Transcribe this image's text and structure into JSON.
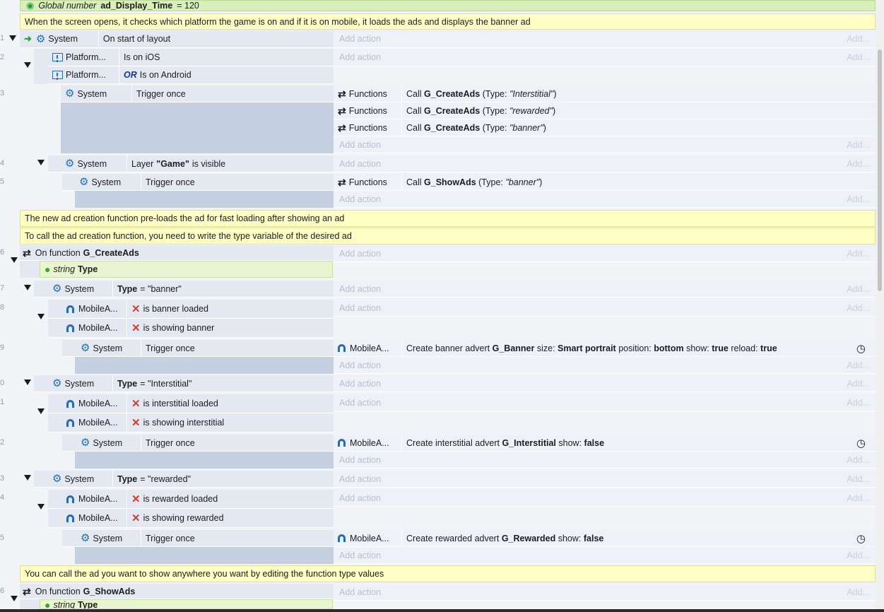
{
  "global_var": {
    "prefix": "Global number",
    "name": "ad_Display_Time",
    "value": "= 120"
  },
  "comments": [
    "When the screen opens, it checks which platform the game is on and if it is on mobile, it loads the ads and displays the banner ad",
    "The new ad creation function pre-loads the ad for fast loading after showing an ad",
    "To call the ad creation function, you need to write the type variable of the desired ad",
    "You can call the ad you want to show anywhere you want by editing the function type values"
  ],
  "line_numbers": [
    "1",
    "2",
    "3",
    "4",
    "5",
    "6",
    "7",
    "8",
    "9",
    "0",
    "1",
    "2",
    "3",
    "4",
    "5",
    "6"
  ],
  "labels": {
    "system": "System",
    "platform": "Platform...",
    "mobile": "MobileA...",
    "functions": "Functions",
    "add_action": "Add action",
    "add": "Add...",
    "trigger_once": "Trigger once",
    "or": "OR",
    "string": "string",
    "type_param": "Type"
  },
  "events": {
    "e1_cond": "On start of layout",
    "e2_c1": "Is on iOS",
    "e2_c2": "Is on Android",
    "e3_actions": [
      {
        "fn": "G_CreateAds",
        "arg": "\"Interstitial\""
      },
      {
        "fn": "G_CreateAds",
        "arg": "\"rewarded\""
      },
      {
        "fn": "G_CreateAds",
        "arg": "\"banner\""
      }
    ],
    "e4_pre": "Layer",
    "e4_layer": "\"Game\"",
    "e4_post": "is visible",
    "e5_fn": "G_ShowAds",
    "e5_arg": "\"banner\"",
    "call": "Call",
    "type_open": "(Type:",
    "close": ")",
    "e6_prefix": "On function",
    "e6_fn": "G_CreateAds",
    "e7_val": "= \"banner\"",
    "e8_c1": "is banner loaded",
    "e8_c2": "is showing banner",
    "e9_act_pre": "Create banner advert",
    "e9_name": "G_Banner",
    "e9_size_lbl": "size:",
    "e9_size": "Smart portrait",
    "e9_pos_lbl": "position:",
    "e9_pos": "bottom",
    "e9_show_lbl": "show:",
    "e9_show": "true",
    "e9_reload_lbl": "reload:",
    "e9_reload": "true",
    "e10_val": "= \"Interstitial\"",
    "e11_c1": "is interstitial loaded",
    "e11_c2": "is showing interstitial",
    "e12_act_pre": "Create interstitial advert",
    "e12_name": "G_Interstitial",
    "e12_show_lbl": "show:",
    "e12_show": "false",
    "e13_val": "= \"rewarded\"",
    "e14_c1": "is rewarded loaded",
    "e14_c2": "is showing rewarded",
    "e15_act_pre": "Create rewarded advert",
    "e15_name": "G_Rewarded",
    "e15_show_lbl": "show:",
    "e15_show": "false",
    "e16_prefix": "On function",
    "e16_fn": "G_ShowAds"
  }
}
